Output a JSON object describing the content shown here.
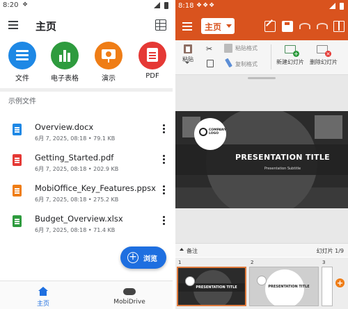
{
  "left": {
    "status": {
      "time": "8:20"
    },
    "appbar": {
      "title": "主页"
    },
    "categories": [
      {
        "label": "文件",
        "icon": "document-icon",
        "color": "#1e88e5"
      },
      {
        "label": "电子表格",
        "icon": "spreadsheet-icon",
        "color": "#2e9b3e"
      },
      {
        "label": "演示",
        "icon": "presentation-icon",
        "color": "#ef7d16"
      },
      {
        "label": "PDF",
        "icon": "pdf-icon",
        "color": "#e53935"
      }
    ],
    "section_title": "示例文件",
    "files": [
      {
        "name": "Overview.docx",
        "meta": "6月 7, 2025, 08:18 • 79.1 KB",
        "type": "docx"
      },
      {
        "name": "Getting_Started.pdf",
        "meta": "6月 7, 2025, 08:18 • 202.9 KB",
        "type": "pdf"
      },
      {
        "name": "MobiOffice_Key_Features.ppsx",
        "meta": "6月 7, 2025, 08:18 • 275.2 KB",
        "type": "ppsx"
      },
      {
        "name": "Budget_Overview.xlsx",
        "meta": "6月 7, 2025, 08:18 • 71.4 KB",
        "type": "xlsx"
      }
    ],
    "fab_label": "浏览",
    "bottom_nav": [
      {
        "label": "主页",
        "icon": "home-icon",
        "active": true
      },
      {
        "label": "MobiDrive",
        "icon": "cloud-icon",
        "active": false
      }
    ]
  },
  "right": {
    "status": {
      "time": "8:18"
    },
    "toolbar": {
      "menu_label": "主页"
    },
    "ribbon": {
      "paste": "粘贴",
      "paste_format": "粘贴格式",
      "copy_format": "复制格式",
      "new_slide": "新建幻灯片",
      "delete_slide": "删除幻灯片"
    },
    "slide": {
      "logo_text": "COMPANY LOGO",
      "title": "PRESENTATION TITLE",
      "subtitle": "Presentation Subtitle"
    },
    "notes_label": "备注",
    "slide_counter": "幻灯片 1/9",
    "thumbnails": [
      {
        "number": "1",
        "title": "PRESENTATION TITLE"
      },
      {
        "number": "2",
        "title": "PRESENTATION TITLE"
      },
      {
        "number": "3",
        "title": ""
      }
    ],
    "accent_color": "#d9531e"
  }
}
